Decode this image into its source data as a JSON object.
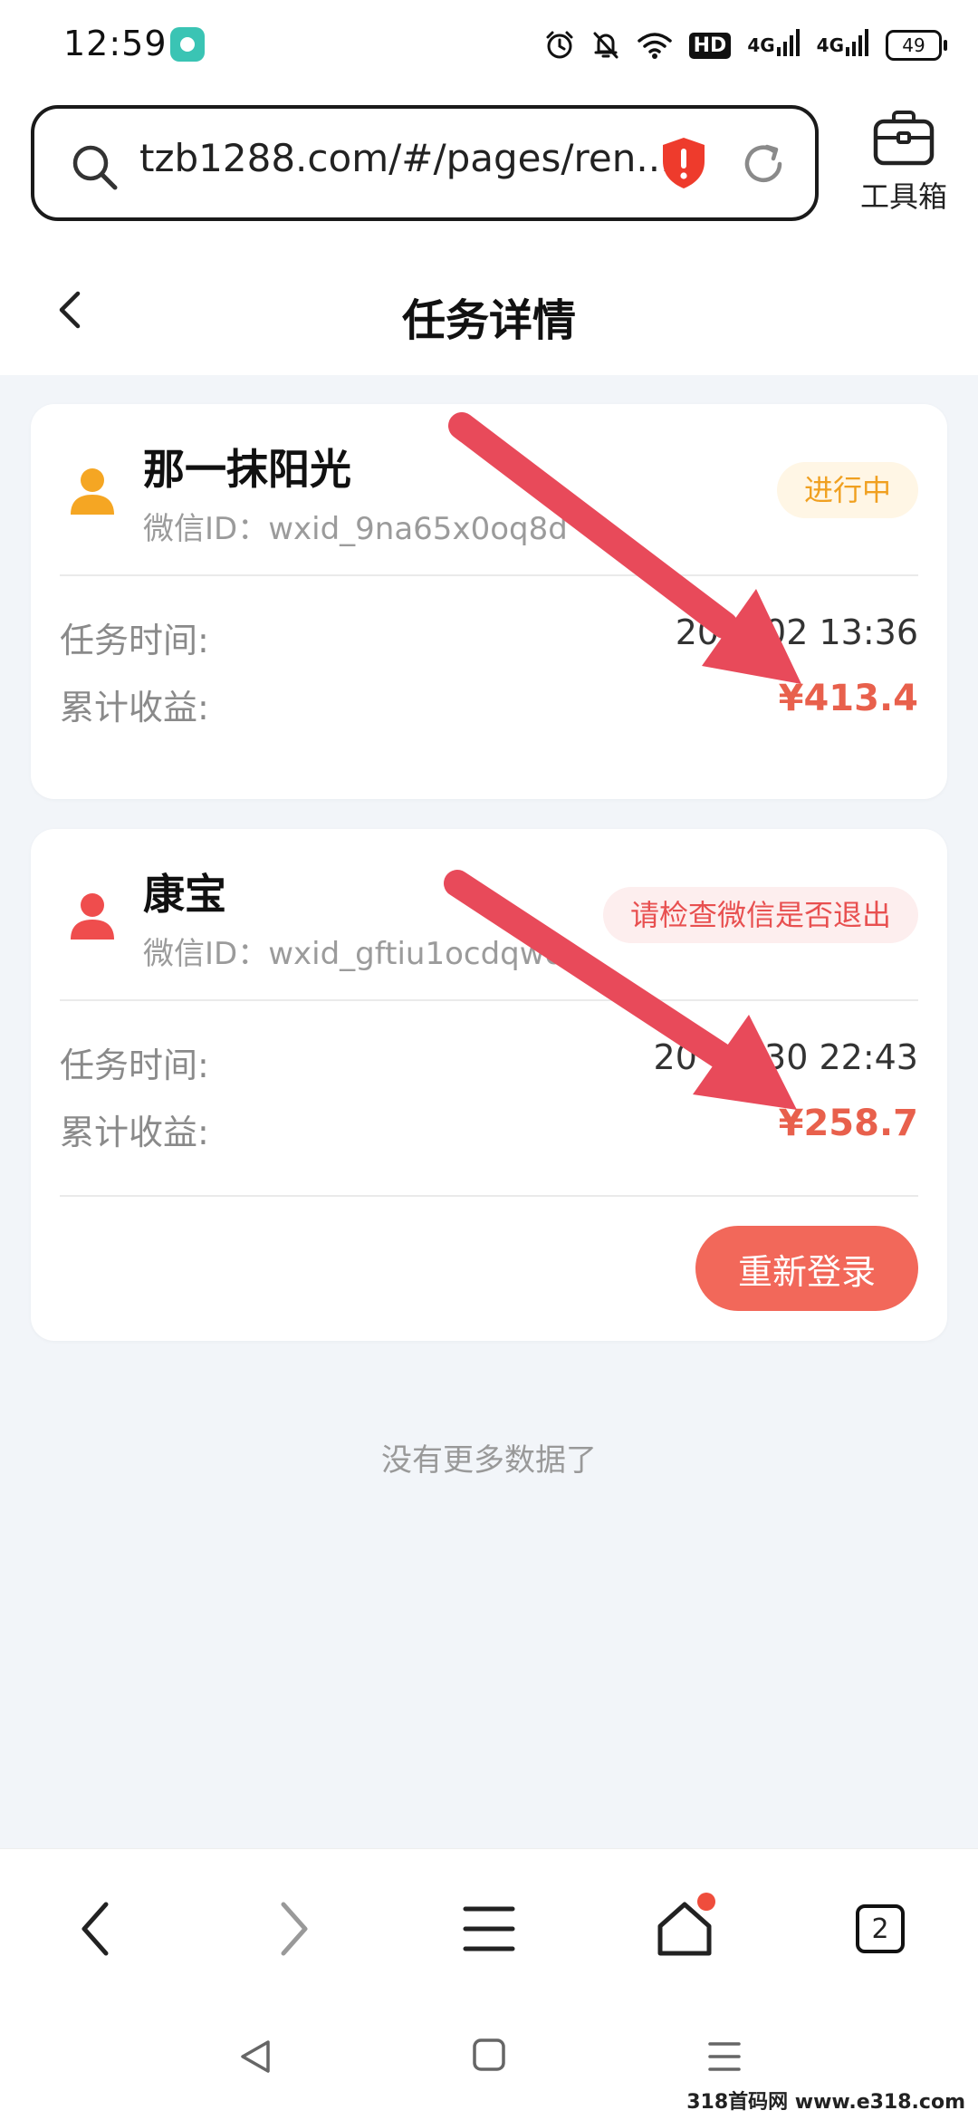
{
  "status_bar": {
    "time": "12:59",
    "hd": "HD",
    "net1": "4G",
    "net2": "4G",
    "battery": "49"
  },
  "address_bar": {
    "url": "tzb1288.com/#/pages/ren...",
    "toolbox_label": "工具箱"
  },
  "page": {
    "title": "任务详情"
  },
  "tasks": [
    {
      "name": "那一抹阳光",
      "wechat_id": "微信ID：wxid_9na65x0oq8dr22",
      "status": "进行中",
      "status_color": "#f0a020",
      "time_label": "任务时间:",
      "time_value": "202  -02 13:36",
      "earnings_label": "累计收益:",
      "earnings_value": "¥413.4",
      "avatar_color": "#f5a623"
    },
    {
      "name": "康宝",
      "wechat_id": "微信ID：wxid_gftiu1ocdqwo",
      "status": "请检查微信是否退出",
      "status_color": "#e85050",
      "time_label": "任务时间:",
      "time_value": "20  11-30 22:43",
      "earnings_label": "累计收益:",
      "earnings_value": "¥258.7",
      "avatar_color": "#ef4d4d",
      "action_label": "重新登录"
    }
  ],
  "footer": {
    "no_more": "没有更多数据了"
  },
  "browser_bar": {
    "tab_count": "2"
  },
  "watermark": "318首码网 www.e318.com",
  "colors": {
    "accent_red": "#f2685a",
    "money": "#e8604c",
    "arrow": "#e84a5a"
  }
}
